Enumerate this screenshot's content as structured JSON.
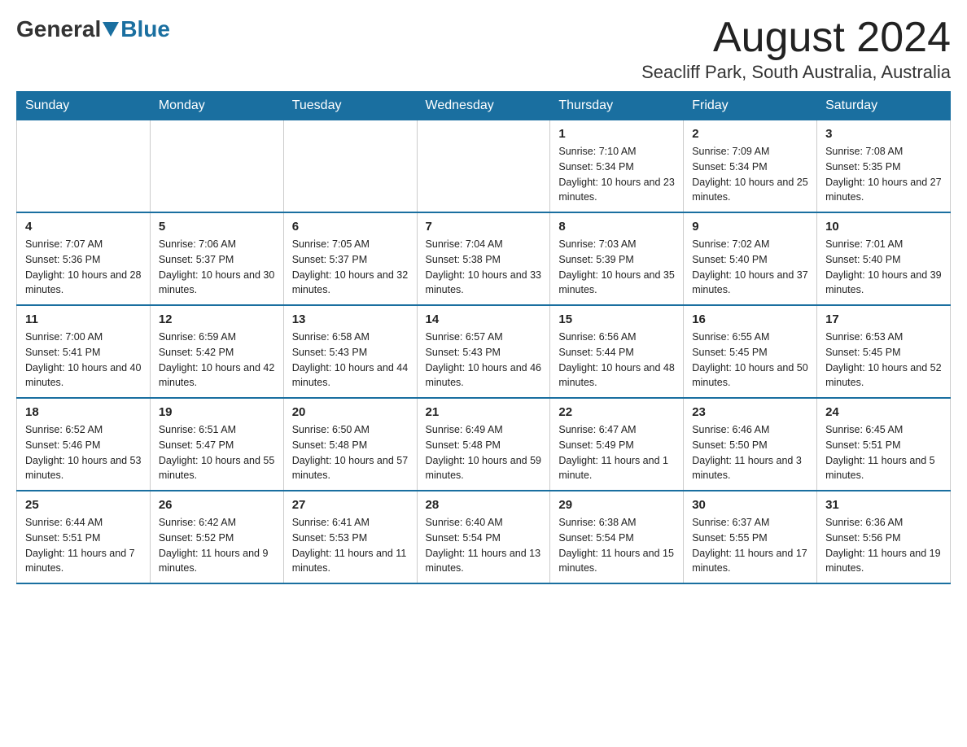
{
  "header": {
    "logo_general": "General",
    "logo_blue": "Blue",
    "month_title": "August 2024",
    "location": "Seacliff Park, South Australia, Australia"
  },
  "days_of_week": [
    "Sunday",
    "Monday",
    "Tuesday",
    "Wednesday",
    "Thursday",
    "Friday",
    "Saturday"
  ],
  "weeks": [
    [
      {
        "day": "",
        "info": ""
      },
      {
        "day": "",
        "info": ""
      },
      {
        "day": "",
        "info": ""
      },
      {
        "day": "",
        "info": ""
      },
      {
        "day": "1",
        "info": "Sunrise: 7:10 AM\nSunset: 5:34 PM\nDaylight: 10 hours and 23 minutes."
      },
      {
        "day": "2",
        "info": "Sunrise: 7:09 AM\nSunset: 5:34 PM\nDaylight: 10 hours and 25 minutes."
      },
      {
        "day": "3",
        "info": "Sunrise: 7:08 AM\nSunset: 5:35 PM\nDaylight: 10 hours and 27 minutes."
      }
    ],
    [
      {
        "day": "4",
        "info": "Sunrise: 7:07 AM\nSunset: 5:36 PM\nDaylight: 10 hours and 28 minutes."
      },
      {
        "day": "5",
        "info": "Sunrise: 7:06 AM\nSunset: 5:37 PM\nDaylight: 10 hours and 30 minutes."
      },
      {
        "day": "6",
        "info": "Sunrise: 7:05 AM\nSunset: 5:37 PM\nDaylight: 10 hours and 32 minutes."
      },
      {
        "day": "7",
        "info": "Sunrise: 7:04 AM\nSunset: 5:38 PM\nDaylight: 10 hours and 33 minutes."
      },
      {
        "day": "8",
        "info": "Sunrise: 7:03 AM\nSunset: 5:39 PM\nDaylight: 10 hours and 35 minutes."
      },
      {
        "day": "9",
        "info": "Sunrise: 7:02 AM\nSunset: 5:40 PM\nDaylight: 10 hours and 37 minutes."
      },
      {
        "day": "10",
        "info": "Sunrise: 7:01 AM\nSunset: 5:40 PM\nDaylight: 10 hours and 39 minutes."
      }
    ],
    [
      {
        "day": "11",
        "info": "Sunrise: 7:00 AM\nSunset: 5:41 PM\nDaylight: 10 hours and 40 minutes."
      },
      {
        "day": "12",
        "info": "Sunrise: 6:59 AM\nSunset: 5:42 PM\nDaylight: 10 hours and 42 minutes."
      },
      {
        "day": "13",
        "info": "Sunrise: 6:58 AM\nSunset: 5:43 PM\nDaylight: 10 hours and 44 minutes."
      },
      {
        "day": "14",
        "info": "Sunrise: 6:57 AM\nSunset: 5:43 PM\nDaylight: 10 hours and 46 minutes."
      },
      {
        "day": "15",
        "info": "Sunrise: 6:56 AM\nSunset: 5:44 PM\nDaylight: 10 hours and 48 minutes."
      },
      {
        "day": "16",
        "info": "Sunrise: 6:55 AM\nSunset: 5:45 PM\nDaylight: 10 hours and 50 minutes."
      },
      {
        "day": "17",
        "info": "Sunrise: 6:53 AM\nSunset: 5:45 PM\nDaylight: 10 hours and 52 minutes."
      }
    ],
    [
      {
        "day": "18",
        "info": "Sunrise: 6:52 AM\nSunset: 5:46 PM\nDaylight: 10 hours and 53 minutes."
      },
      {
        "day": "19",
        "info": "Sunrise: 6:51 AM\nSunset: 5:47 PM\nDaylight: 10 hours and 55 minutes."
      },
      {
        "day": "20",
        "info": "Sunrise: 6:50 AM\nSunset: 5:48 PM\nDaylight: 10 hours and 57 minutes."
      },
      {
        "day": "21",
        "info": "Sunrise: 6:49 AM\nSunset: 5:48 PM\nDaylight: 10 hours and 59 minutes."
      },
      {
        "day": "22",
        "info": "Sunrise: 6:47 AM\nSunset: 5:49 PM\nDaylight: 11 hours and 1 minute."
      },
      {
        "day": "23",
        "info": "Sunrise: 6:46 AM\nSunset: 5:50 PM\nDaylight: 11 hours and 3 minutes."
      },
      {
        "day": "24",
        "info": "Sunrise: 6:45 AM\nSunset: 5:51 PM\nDaylight: 11 hours and 5 minutes."
      }
    ],
    [
      {
        "day": "25",
        "info": "Sunrise: 6:44 AM\nSunset: 5:51 PM\nDaylight: 11 hours and 7 minutes."
      },
      {
        "day": "26",
        "info": "Sunrise: 6:42 AM\nSunset: 5:52 PM\nDaylight: 11 hours and 9 minutes."
      },
      {
        "day": "27",
        "info": "Sunrise: 6:41 AM\nSunset: 5:53 PM\nDaylight: 11 hours and 11 minutes."
      },
      {
        "day": "28",
        "info": "Sunrise: 6:40 AM\nSunset: 5:54 PM\nDaylight: 11 hours and 13 minutes."
      },
      {
        "day": "29",
        "info": "Sunrise: 6:38 AM\nSunset: 5:54 PM\nDaylight: 11 hours and 15 minutes."
      },
      {
        "day": "30",
        "info": "Sunrise: 6:37 AM\nSunset: 5:55 PM\nDaylight: 11 hours and 17 minutes."
      },
      {
        "day": "31",
        "info": "Sunrise: 6:36 AM\nSunset: 5:56 PM\nDaylight: 11 hours and 19 minutes."
      }
    ]
  ]
}
